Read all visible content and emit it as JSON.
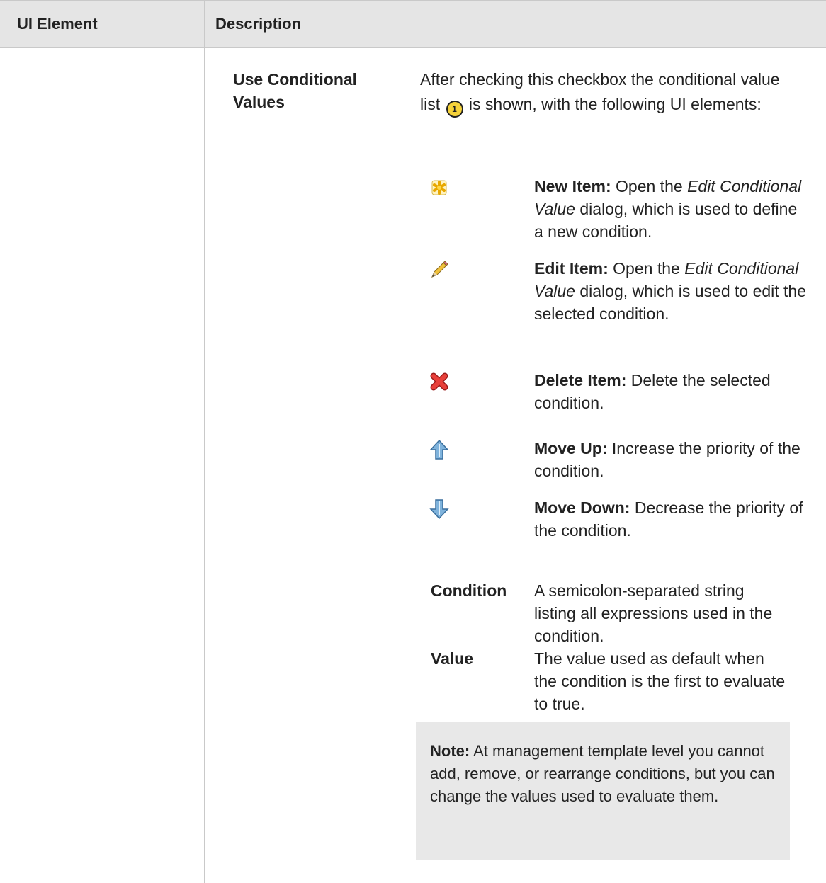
{
  "header": {
    "col1": "UI Element",
    "col2": "Description"
  },
  "row": {
    "label": "Use Conditional Values",
    "intro_a": "After checking this checkbox the conditional value list",
    "callout": "1",
    "intro_b": "is shown, with the following UI elements:"
  },
  "items": [
    {
      "icon": "new-item-asterisk-icon",
      "name": "New Item:",
      "text_pre": "Open the ",
      "text_italic": "Edit Conditional Value",
      "text_post": " dialog, which is used to define a new condition."
    },
    {
      "icon": "pencil-icon",
      "name": "Edit Item:",
      "text_pre": "Open the ",
      "text_italic": "Edit Conditional Value",
      "text_post": " dialog, which is used to edit the selected condition."
    },
    {
      "icon": "delete-x-icon",
      "name": "Delete Item:",
      "text_pre": "",
      "text_italic": "",
      "text_post": " Delete the selected condition."
    },
    {
      "icon": "arrow-up-icon",
      "name": "Move Up:",
      "text_pre": "",
      "text_italic": "",
      "text_post": " Increase the priority of the condition."
    },
    {
      "icon": "arrow-down-icon",
      "name": "Move Down:",
      "text_pre": "",
      "text_italic": "",
      "text_post": " Decrease the priority of the condition."
    }
  ],
  "fields": [
    {
      "label": "Condition",
      "desc": "A semicolon-separated string listing all expressions used in the condition."
    },
    {
      "label": "Value",
      "desc": "The value used as default when the condition is the first to evaluate to true."
    }
  ],
  "note": {
    "label": "Note:",
    "text": " At management template level you cannot add, remove, or rearrange conditions, but you can change the values used to evaluate them."
  },
  "colors": {
    "header_bg": "#e5e5e5",
    "note_bg": "#e8e8e8",
    "callout_fill": "#f5d23a"
  }
}
